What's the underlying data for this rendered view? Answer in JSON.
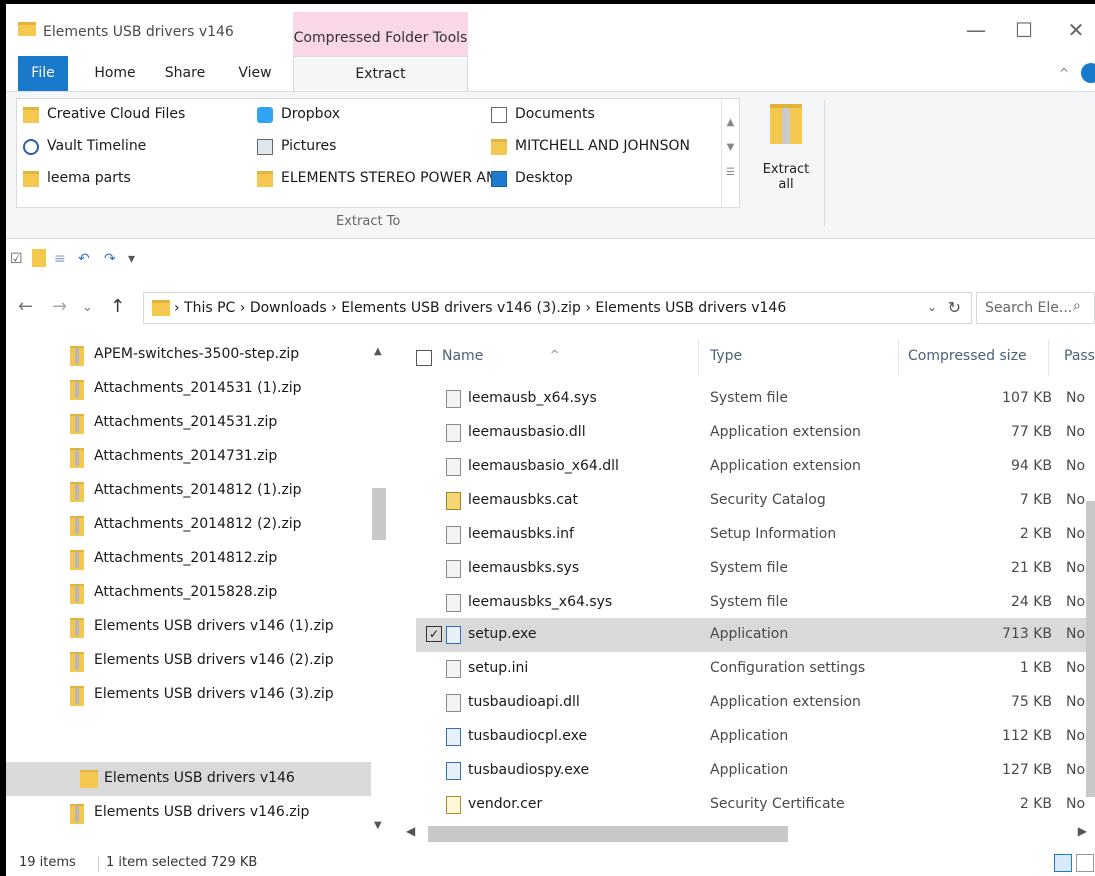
{
  "window": {
    "title": "Elements USB drivers v146",
    "context_tab": "Compressed Folder Tools",
    "minimize": "—",
    "maximize": "☐",
    "close": "✕"
  },
  "ribbon_tabs": {
    "file": "File",
    "home": "Home",
    "share": "Share",
    "view": "View",
    "extract": "Extract",
    "collapse": "^"
  },
  "extract_to": {
    "group_label": "Extract To",
    "destinations": [
      {
        "label": "Creative Cloud Files",
        "icon": "creative-cloud-folder-icon"
      },
      {
        "label": "Dropbox",
        "icon": "dropbox-icon"
      },
      {
        "label": "Documents",
        "icon": "documents-icon"
      },
      {
        "label": "Vault Timeline",
        "icon": "vault-icon"
      },
      {
        "label": "Pictures",
        "icon": "pictures-icon"
      },
      {
        "label": "MITCHELL AND JOHNSON",
        "icon": "folder-icon"
      },
      {
        "label": "leema parts",
        "icon": "folder-icon"
      },
      {
        "label": "ELEMENTS STEREO POWER AMP",
        "icon": "folder-icon"
      },
      {
        "label": "Desktop",
        "icon": "desktop-icon"
      }
    ],
    "extract_all_line1": "Extract",
    "extract_all_line2": "all"
  },
  "quick_access": {
    "check": "☑",
    "undo": "↶",
    "redo": "↷",
    "customize": "▾"
  },
  "navigation": {
    "back": "←",
    "forward": "→",
    "recent": "⌄",
    "up": "↑",
    "breadcrumb": "›  This PC  ›  Downloads  ›  Elements USB drivers v146 (3).zip  ›  Elements USB drivers v146",
    "dropdown": "⌄",
    "refresh": "↻",
    "search_placeholder": "Search Ele...",
    "search_icon": "⌕"
  },
  "nav_pane": {
    "items": [
      {
        "label": "APEM-switches-3500-step.zip",
        "selected": false
      },
      {
        "label": "Attachments_2014531 (1).zip",
        "selected": false
      },
      {
        "label": "Attachments_2014531.zip",
        "selected": false
      },
      {
        "label": "Attachments_2014731.zip",
        "selected": false
      },
      {
        "label": "Attachments_2014812 (1).zip",
        "selected": false
      },
      {
        "label": "Attachments_2014812 (2).zip",
        "selected": false
      },
      {
        "label": "Attachments_2014812.zip",
        "selected": false
      },
      {
        "label": "Attachments_2015828.zip",
        "selected": false
      },
      {
        "label": "Elements USB drivers v146 (1).zip",
        "selected": false
      },
      {
        "label": "Elements USB drivers v146 (2).zip",
        "selected": false
      },
      {
        "label": "Elements USB drivers v146 (3).zip",
        "selected": false
      },
      {
        "label": "Elements USB drivers v146",
        "selected": true
      },
      {
        "label": "Elements USB drivers v146.zip",
        "selected": false
      }
    ]
  },
  "file_list": {
    "columns": {
      "name": "Name",
      "type": "Type",
      "size": "Compressed size",
      "password": "Pass"
    },
    "sort_indicator": "^",
    "rows": [
      {
        "name": "leemausb_x64.sys",
        "type": "System file",
        "size": "107 KB",
        "password": "No",
        "icon": "sys",
        "selected": false
      },
      {
        "name": "leemausbasio.dll",
        "type": "Application extension",
        "size": "77 KB",
        "password": "No",
        "icon": "sys",
        "selected": false
      },
      {
        "name": "leemausbasio_x64.dll",
        "type": "Application extension",
        "size": "94 KB",
        "password": "No",
        "icon": "sys",
        "selected": false
      },
      {
        "name": "leemausbks.cat",
        "type": "Security Catalog",
        "size": "7 KB",
        "password": "No",
        "icon": "cat",
        "selected": false
      },
      {
        "name": "leemausbks.inf",
        "type": "Setup Information",
        "size": "2 KB",
        "password": "No",
        "icon": "sys",
        "selected": false
      },
      {
        "name": "leemausbks.sys",
        "type": "System file",
        "size": "21 KB",
        "password": "No",
        "icon": "sys",
        "selected": false
      },
      {
        "name": "leemausbks_x64.sys",
        "type": "System file",
        "size": "24 KB",
        "password": "No",
        "icon": "sys",
        "selected": false
      },
      {
        "name": "setup.exe",
        "type": "Application",
        "size": "713 KB",
        "password": "No",
        "icon": "exe",
        "selected": true
      },
      {
        "name": "setup.ini",
        "type": "Configuration settings",
        "size": "1 KB",
        "password": "No",
        "icon": "sys",
        "selected": false
      },
      {
        "name": "tusbaudioapi.dll",
        "type": "Application extension",
        "size": "75 KB",
        "password": "No",
        "icon": "sys",
        "selected": false
      },
      {
        "name": "tusbaudiocpl.exe",
        "type": "Application",
        "size": "112 KB",
        "password": "No",
        "icon": "exe",
        "selected": false
      },
      {
        "name": "tusbaudiospy.exe",
        "type": "Application",
        "size": "127 KB",
        "password": "No",
        "icon": "exe",
        "selected": false
      },
      {
        "name": "vendor.cer",
        "type": "Security Certificate",
        "size": "2 KB",
        "password": "No",
        "icon": "cer",
        "selected": false
      }
    ]
  },
  "status_bar": {
    "item_count": "19 items",
    "selection": "1 item selected  729 KB"
  },
  "colors": {
    "accent": "#1979ca",
    "context_tab": "#f9d7e8",
    "selection": "#d9d9d9"
  }
}
